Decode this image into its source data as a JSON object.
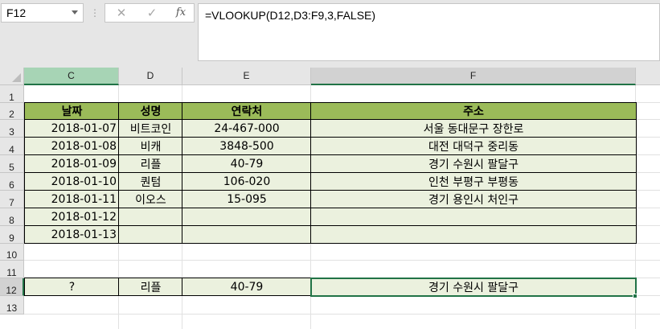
{
  "name_box": {
    "value": "F12"
  },
  "formula_bar": {
    "formula": "=VLOOKUP(D12,D3:F9,3,FALSE)"
  },
  "toolbar_icons": {
    "cancel": "✕",
    "enter": "✓",
    "fx": "fx"
  },
  "columns": [
    "C",
    "D",
    "E",
    "F"
  ],
  "rows": [
    "1",
    "2",
    "3",
    "4",
    "5",
    "6",
    "7",
    "8",
    "9",
    "10",
    "11",
    "12",
    "13"
  ],
  "table": {
    "headers": [
      "날짜",
      "성명",
      "연락처",
      "주소"
    ],
    "rows": [
      [
        "2018-01-07",
        "비트코인",
        "24-467-000",
        "서울 동대문구 장한로"
      ],
      [
        "2018-01-08",
        "비캐",
        "3848-500",
        "대전 대덕구 중리동"
      ],
      [
        "2018-01-09",
        "리플",
        "40-79",
        "경기 수원시 팔달구"
      ],
      [
        "2018-01-10",
        "퀀텀",
        "106-020",
        "인천 부평구 부평동"
      ],
      [
        "2018-01-11",
        "이오스",
        "15-095",
        "경기 용인시 처인구"
      ],
      [
        "2018-01-12",
        "",
        "",
        ""
      ],
      [
        "2018-01-13",
        "",
        "",
        ""
      ]
    ]
  },
  "lookup": {
    "c": "?",
    "d": "리플",
    "e": "40-79",
    "f": "경기 수원시 팔달구"
  },
  "colors": {
    "header_fill": "#9bbb59",
    "body_fill": "#ebf1de",
    "selection": "#217346"
  }
}
